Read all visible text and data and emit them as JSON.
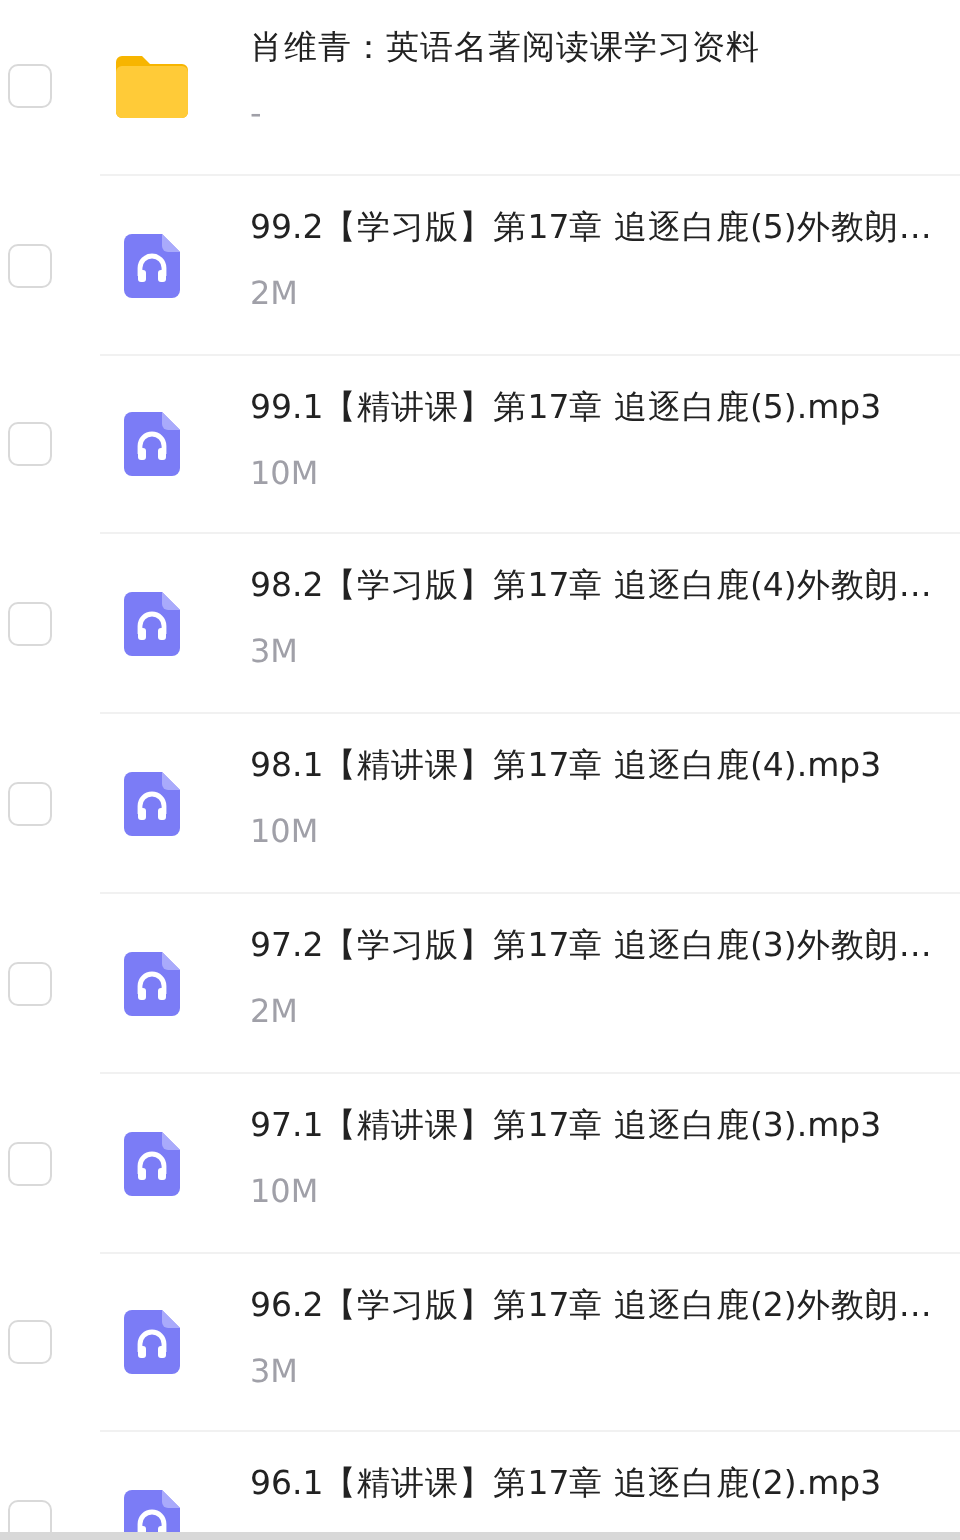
{
  "files": [
    {
      "kind": "folder",
      "name": "肖维青：英语名著阅读课学习资料",
      "size": "-",
      "checked": false
    },
    {
      "kind": "audio",
      "name": "99.2【学习版】第17章 追逐白鹿(5)外教朗…",
      "size": "2M",
      "checked": false
    },
    {
      "kind": "audio",
      "name": "99.1【精讲课】第17章 追逐白鹿(5).mp3",
      "size": "10M",
      "checked": false
    },
    {
      "kind": "audio",
      "name": "98.2【学习版】第17章 追逐白鹿(4)外教朗…",
      "size": "3M",
      "checked": false
    },
    {
      "kind": "audio",
      "name": "98.1【精讲课】第17章 追逐白鹿(4).mp3",
      "size": "10M",
      "checked": false
    },
    {
      "kind": "audio",
      "name": "97.2【学习版】第17章 追逐白鹿(3)外教朗…",
      "size": "2M",
      "checked": false
    },
    {
      "kind": "audio",
      "name": "97.1【精讲课】第17章 追逐白鹿(3).mp3",
      "size": "10M",
      "checked": false
    },
    {
      "kind": "audio",
      "name": "96.2【学习版】第17章 追逐白鹿(2)外教朗…",
      "size": "3M",
      "checked": false
    },
    {
      "kind": "audio",
      "name": "96.1【精讲课】第17章 追逐白鹿(2).mp3",
      "checked": false
    }
  ]
}
